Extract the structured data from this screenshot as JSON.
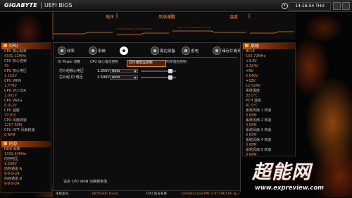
{
  "topbar": {
    "brand": "GIGABYTE",
    "title": "UEFI BIOS",
    "time": "14:16:54 THU"
  },
  "monitor": {
    "voltage_label": "电压",
    "fan_label": "风扇速度",
    "temp_label": "温度"
  },
  "cpu_panel": {
    "title": "CPU",
    "items": [
      {
        "label": "CPU 核心频率",
        "value": "4331.12MHz"
      },
      {
        "label": "CPU 核心倍频",
        "value": "43"
      },
      {
        "label": "CPU 核心电压",
        "value": "1.152V"
      },
      {
        "label": "CPU VRIN",
        "value": "1.776V"
      },
      {
        "label": "CPU VCCIOA",
        "value": "1.001V"
      },
      {
        "label": "CPU VAXG",
        "value": "0.012V"
      },
      {
        "label": "CPU 温度",
        "value": "37.0°C"
      },
      {
        "label": "CPU 风扇转速",
        "value": "1257 RPM"
      },
      {
        "label": "CPU OPT 风扇转速",
        "value": "0 RPM"
      }
    ]
  },
  "memory_panel": {
    "title": "内存",
    "items": [
      {
        "label": "DDR 频率",
        "value": "1333.44MHz"
      },
      {
        "label": "内存电压",
        "value": "1.500V"
      },
      {
        "label": "内存通道 A",
        "value": "9-9-9-24"
      },
      {
        "label": "内存通道 B",
        "value": "9-9-9-24"
      }
    ]
  },
  "system_panel": {
    "title": "系统",
    "items": [
      {
        "label": "BCLK",
        "value": "100.72MHz"
      },
      {
        "label": "+3.3V",
        "value": "3.324V"
      },
      {
        "label": "+5V",
        "value": "5.040V"
      },
      {
        "label": "+12V",
        "value": "12.024V"
      },
      {
        "label": "系统温度",
        "value": "32.0°C"
      },
      {
        "label": "PCH 温度",
        "value": "41.0°C"
      },
      {
        "label": "系统风扇 1 转速",
        "value": "0 RPM"
      },
      {
        "label": "系统风扇 2 转速",
        "value": "0 RPM"
      },
      {
        "label": "系统风扇 3 转速",
        "value": "0 RPM"
      },
      {
        "label": "系统风扇 4 转速",
        "value": "0 RPM"
      },
      {
        "label": "系统风扇 5 转速",
        "value": "0 RPM"
      }
    ]
  },
  "tabs": [
    {
      "label": "频率",
      "icon": "frequency-icon",
      "active": false
    },
    {
      "label": "系统",
      "icon": "system-icon",
      "active": false
    },
    {
      "icon": "bios-features-icon",
      "active": true
    },
    {
      "label": "周边设备",
      "icon": "peripherals-icon",
      "active": false
    },
    {
      "label": "省电",
      "icon": "power-icon",
      "active": false
    },
    {
      "label": "储存并离开",
      "icon": "save-exit-icon",
      "active": false
    }
  ],
  "subtabs": [
    {
      "label": "IO Power 调整",
      "active": false
    },
    {
      "label": "CPU 核心电压控制",
      "active": false
    },
    {
      "label": "芯片组电压控制",
      "active": true
    },
    {
      "label": "内存电压控制",
      "active": false
    }
  ],
  "settings": [
    {
      "label": "芯片组核心电压",
      "value": "1.050V",
      "mode": "Auto",
      "level": 0.88
    },
    {
      "label": "芯片组 IO 电压",
      "value": "1.500V",
      "mode": "Auto",
      "level": 0.88
    }
  ],
  "help_text": "设定 CPU VRIN 切换频率值",
  "status": {
    "board_label": "主板型号",
    "board": "Z87X-SOC Force",
    "cpu_label": "CPU 型号名称",
    "cpu": "Intel(R) Core(TM) i7-4770K CPU @ 3.50GHz"
  },
  "watermark": {
    "logo": "超能网",
    "url": "www.expreview.com"
  },
  "colors": {
    "accent": "#ff7a00",
    "value_text": "#ff8a1f",
    "panel_bg": "#0e0e0e",
    "active_tab": "#ffffff"
  }
}
